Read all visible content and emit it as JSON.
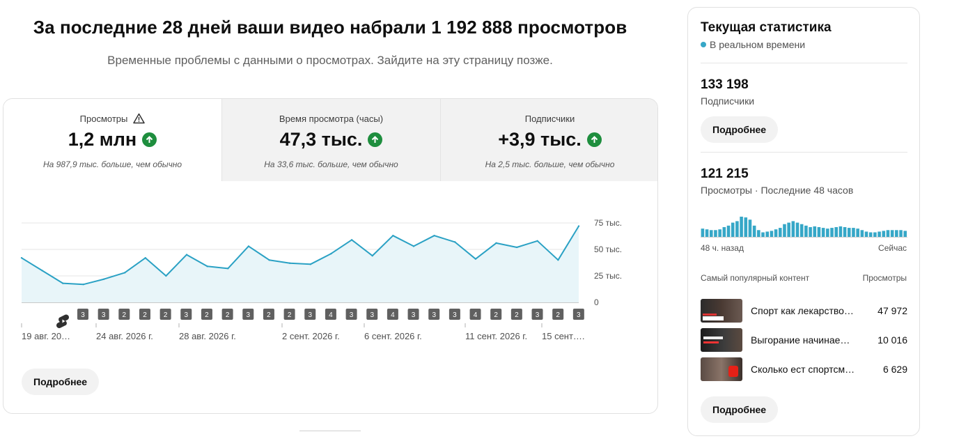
{
  "header": {
    "title": "За последние 28 дней ваши видео набрали 1 192 888 просмотров",
    "notice": "Временные проблемы с данными о просмотрах. Зайдите на эту страницу позже."
  },
  "metrics": {
    "tabs": [
      {
        "label": "Просмотры",
        "value": "1,2 млн",
        "note": "На 987,9 тыс. больше, чем обычно",
        "warning": true
      },
      {
        "label": "Время просмотра (часы)",
        "value": "47,3 тыс.",
        "note": "На 33,6 тыс. больше, чем обычно"
      },
      {
        "label": "Подписчики",
        "value": "+3,9 тыс.",
        "note": "На 2,5 тыс. больше, чем обычно"
      }
    ],
    "more_label": "Подробнее"
  },
  "chart_data": {
    "type": "area",
    "y_ticks": [
      "75 тыс.",
      "50 тыс.",
      "25 тыс.",
      "0"
    ],
    "ylim": [
      0,
      80000
    ],
    "values": [
      42000,
      30000,
      18000,
      17000,
      22000,
      28000,
      42000,
      25000,
      45000,
      34000,
      32000,
      53000,
      40000,
      37000,
      36000,
      46000,
      59000,
      44000,
      63000,
      53000,
      63000,
      57000,
      41000,
      56000,
      52000,
      58000,
      40000,
      72000
    ],
    "upload_markers": [
      "3",
      "3",
      "2",
      "2",
      "2",
      "3",
      "2",
      "2",
      "3",
      "2",
      "2",
      "3",
      "4",
      "3",
      "3",
      "4",
      "3",
      "3",
      "3",
      "4",
      "2",
      "2",
      "3",
      "2",
      "3"
    ],
    "x_labels": [
      "19 авг. 20…",
      "24 авг. 2026 г.",
      "28 авг. 2026 г.",
      "2 сент. 2026 г.",
      "6 сент. 2026 г.",
      "11 сент. 2026 г.",
      "15 сент…."
    ],
    "color": "#2aa1c4",
    "fill": "#e8f5f9",
    "grid": true
  },
  "realtime": {
    "title": "Текущая статистика",
    "live_label": "В реальном времени",
    "subscribers_value": "133 198",
    "subscribers_label": "Подписчики",
    "more_label": "Подробнее",
    "views_value": "121 215",
    "views_label": "Просмотры · Последние 48 часов",
    "hourly_views": [
      12,
      11,
      10,
      10,
      11,
      14,
      16,
      20,
      22,
      28,
      27,
      24,
      16,
      10,
      7,
      8,
      9,
      11,
      13,
      18,
      20,
      22,
      20,
      18,
      16,
      14,
      15,
      14,
      13,
      12,
      13,
      14,
      15,
      14,
      13,
      13,
      12,
      10,
      8,
      7,
      7,
      8,
      9,
      10,
      10,
      10,
      10,
      9
    ],
    "bar_color": "#36a7c7",
    "axis_left": "48 ч. назад",
    "axis_right": "Сейчас",
    "top_content_label": "Самый популярный контент",
    "top_views_label": "Просмотры",
    "top_content": [
      {
        "title": "Спорт как лекарство…",
        "views": "47 972"
      },
      {
        "title": "Выгорание начинае…",
        "views": "10 016"
      },
      {
        "title": "Сколько ест спортсм…",
        "views": "6 629"
      }
    ],
    "more_label_2": "Подробнее"
  }
}
